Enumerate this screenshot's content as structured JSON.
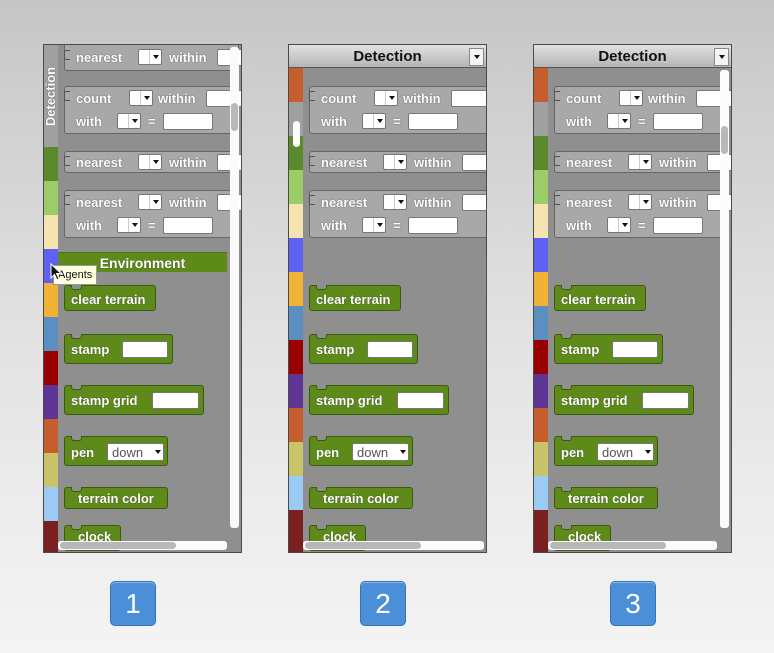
{
  "panels": [
    {
      "vertical_label": "Detection",
      "category_label": "Environment",
      "tooltip": "Agents",
      "blocks": {
        "nearest_1": "nearest",
        "within": "within",
        "count": "count",
        "with": "with",
        "equals": "=",
        "clear_terrain": "clear terrain",
        "stamp": "stamp",
        "stamp_grid": "stamp grid",
        "pen": "pen",
        "pen_value": "down",
        "terrain_color": "terrain color",
        "clock": "clock"
      }
    },
    {
      "header_title": "Detection",
      "blocks": {
        "within": "within",
        "count": "count",
        "with": "with",
        "equals": "=",
        "nearest": "nearest",
        "clear_terrain": "clear terrain",
        "stamp": "stamp",
        "stamp_grid": "stamp grid",
        "pen": "pen",
        "pen_value": "down",
        "terrain_color": "terrain color",
        "clock": "clock"
      }
    },
    {
      "header_title": "Detection",
      "blocks": {
        "within": "within",
        "count": "count",
        "with": "with",
        "equals": "=",
        "nearest": "nearest",
        "clear_terrain": "clear terrain",
        "stamp": "stamp",
        "stamp_grid": "stamp grid",
        "pen": "pen",
        "pen_value": "down",
        "terrain_color": "terrain color",
        "clock": "clock"
      }
    }
  ],
  "badges": [
    "1",
    "2",
    "3"
  ],
  "colors": {
    "green_block": "#5e8a1a",
    "condition_block": "#a8a8a8",
    "panel_bg": "#8f8f8f",
    "badge": "#4a8fd8"
  },
  "palette_swatches": [
    "#a0a0a0",
    "#5a8a2c",
    "#9ccc65",
    "#f5e3b0",
    "#5f60f4",
    "#f2b236",
    "#5b8fc2",
    "#990000",
    "#5e3494",
    "#c65d2c",
    "#c9c46a",
    "#9bcbf5",
    "#7b2020"
  ]
}
